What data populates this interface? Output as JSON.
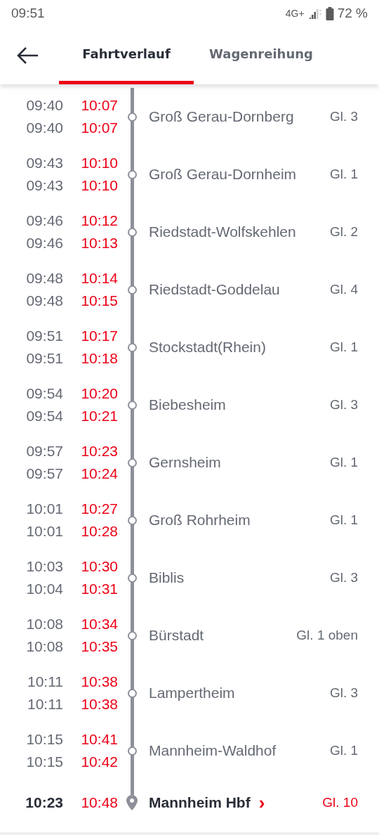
{
  "status_bar": {
    "time": "09:51",
    "network": "4G+",
    "battery": "72 %"
  },
  "tabs": [
    {
      "label": "Fahrtverlauf",
      "selected": true
    },
    {
      "label": "Wagenreihung",
      "selected": false
    }
  ],
  "stops": [
    {
      "kind": "stop",
      "arrival": {
        "scheduled": "09:40",
        "actual": "10:07"
      },
      "departure": {
        "scheduled": "09:40",
        "actual": "10:07"
      },
      "delayed": true,
      "name": "Groß Gerau-Dornberg",
      "platform": "Gl. 3",
      "platform_changed": false
    },
    {
      "kind": "stop",
      "arrival": {
        "scheduled": "09:43",
        "actual": "10:10"
      },
      "departure": {
        "scheduled": "09:43",
        "actual": "10:10"
      },
      "delayed": true,
      "name": "Groß Gerau-Dornheim",
      "platform": "Gl. 1",
      "platform_changed": false
    },
    {
      "kind": "stop",
      "arrival": {
        "scheduled": "09:46",
        "actual": "10:12"
      },
      "departure": {
        "scheduled": "09:46",
        "actual": "10:13"
      },
      "delayed": true,
      "name": "Riedstadt-Wolfskehlen",
      "platform": "Gl. 2",
      "platform_changed": false
    },
    {
      "kind": "stop",
      "arrival": {
        "scheduled": "09:48",
        "actual": "10:14"
      },
      "departure": {
        "scheduled": "09:48",
        "actual": "10:15"
      },
      "delayed": true,
      "name": "Riedstadt-Goddelau",
      "platform": "Gl. 4",
      "platform_changed": false
    },
    {
      "kind": "stop",
      "arrival": {
        "scheduled": "09:51",
        "actual": "10:17"
      },
      "departure": {
        "scheduled": "09:51",
        "actual": "10:18"
      },
      "delayed": true,
      "name": "Stockstadt(Rhein)",
      "platform": "Gl. 1",
      "platform_changed": false
    },
    {
      "kind": "stop",
      "arrival": {
        "scheduled": "09:54",
        "actual": "10:20"
      },
      "departure": {
        "scheduled": "09:54",
        "actual": "10:21"
      },
      "delayed": true,
      "name": "Biebesheim",
      "platform": "Gl. 3",
      "platform_changed": false
    },
    {
      "kind": "stop",
      "arrival": {
        "scheduled": "09:57",
        "actual": "10:23"
      },
      "departure": {
        "scheduled": "09:57",
        "actual": "10:24"
      },
      "delayed": true,
      "name": "Gernsheim",
      "platform": "Gl. 1",
      "platform_changed": false
    },
    {
      "kind": "stop",
      "arrival": {
        "scheduled": "10:01",
        "actual": "10:27"
      },
      "departure": {
        "scheduled": "10:01",
        "actual": "10:28"
      },
      "delayed": true,
      "name": "Groß Rohrheim",
      "platform": "Gl. 1",
      "platform_changed": false
    },
    {
      "kind": "stop",
      "arrival": {
        "scheduled": "10:03",
        "actual": "10:30"
      },
      "departure": {
        "scheduled": "10:04",
        "actual": "10:31"
      },
      "delayed": true,
      "name": "Biblis",
      "platform": "Gl. 3",
      "platform_changed": false
    },
    {
      "kind": "stop",
      "arrival": {
        "scheduled": "10:08",
        "actual": "10:34"
      },
      "departure": {
        "scheduled": "10:08",
        "actual": "10:35"
      },
      "delayed": true,
      "name": "Bürstadt",
      "platform": "Gl. 1 oben",
      "platform_changed": false
    },
    {
      "kind": "stop",
      "arrival": {
        "scheduled": "10:11",
        "actual": "10:38"
      },
      "departure": {
        "scheduled": "10:11",
        "actual": "10:38"
      },
      "delayed": true,
      "name": "Lampertheim",
      "platform": "Gl. 3",
      "platform_changed": false
    },
    {
      "kind": "stop",
      "arrival": {
        "scheduled": "10:15",
        "actual": "10:41"
      },
      "departure": {
        "scheduled": "10:15",
        "actual": "10:42"
      },
      "delayed": true,
      "name": "Mannheim-Waldhof",
      "platform": "Gl. 1",
      "platform_changed": false
    },
    {
      "kind": "destination",
      "arrival": {
        "scheduled": "10:23",
        "actual": "10:48"
      },
      "delayed": true,
      "name": "Mannheim Hbf",
      "link_glyph": "›",
      "platform": "Gl. 10",
      "platform_changed": true
    }
  ]
}
